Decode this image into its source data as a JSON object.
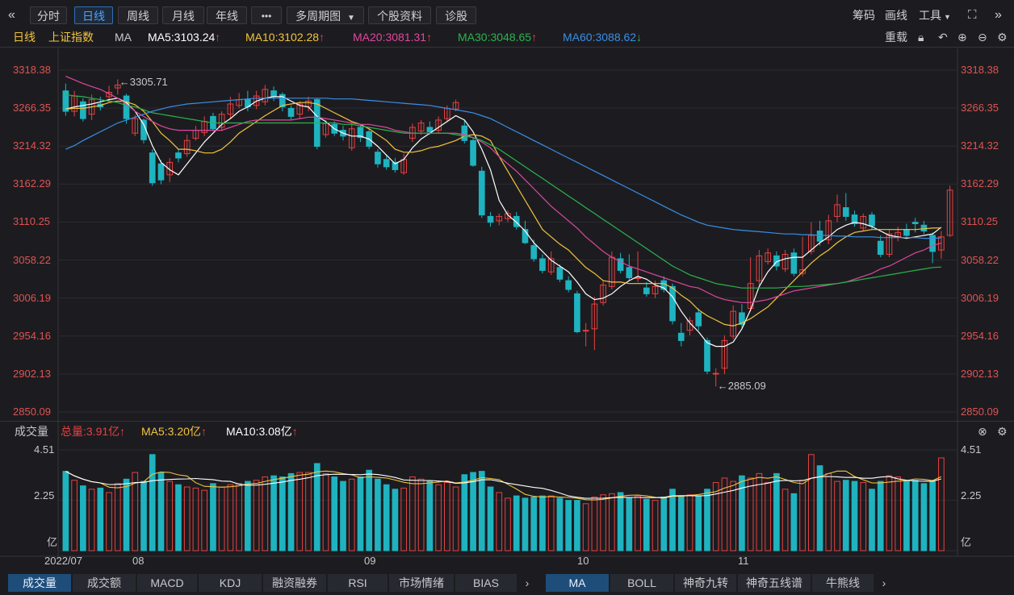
{
  "toolbar": {
    "back_icon": "«",
    "tabs": [
      "分时",
      "日线",
      "周线",
      "月线",
      "年线"
    ],
    "more_icon": "•••",
    "multi_period": "多周期图",
    "stock_info": "个股资料",
    "diagnose": "诊股",
    "right": [
      "筹码",
      "画线",
      "工具"
    ],
    "expand_icon": "⛶",
    "collapse_icon": "»"
  },
  "ma_bar": {
    "period": "日线",
    "index_name": "上证指数",
    "ma_label": "MA",
    "ma5": "MA5:3103.24",
    "ma10": "MA10:3102.28",
    "ma20": "MA20:3081.31",
    "ma30": "MA30:3048.65",
    "ma60": "MA60:3088.62",
    "reweight": "重载",
    "colors": {
      "ma5": "#ffffff",
      "ma10": "#f3c33c",
      "ma20": "#e0479e",
      "ma30": "#2bb34d",
      "ma60": "#3a8ee6"
    }
  },
  "price_axis": [
    "3318.38",
    "3266.35",
    "3214.32",
    "3162.29",
    "3110.25",
    "3058.22",
    "3006.19",
    "2954.16",
    "2902.13",
    "2850.09"
  ],
  "annotations": {
    "high": "3305.71",
    "low": "2885.09"
  },
  "volume_bar": {
    "label": "成交量",
    "total": "总量:3.91亿",
    "ma5": "MA5:3.20亿",
    "ma10": "MA10:3.08亿"
  },
  "volume_axis": [
    "4.51",
    "2.25",
    "亿"
  ],
  "x_axis": [
    "2022/07",
    "08",
    "09",
    "10",
    "11"
  ],
  "bottom_tabs_left": [
    "成交量",
    "成交额",
    "MACD",
    "KDJ",
    "融资融券",
    "RSI",
    "市场情绪",
    "BIAS"
  ],
  "bottom_tabs_right": [
    "MA",
    "BOLL",
    "神奇九转",
    "神奇五线谱",
    "牛熊线"
  ],
  "chart_data": {
    "type": "candlestick",
    "ylim": [
      2850.09,
      3318.38
    ],
    "volume_ylim": [
      0,
      4.51
    ],
    "candles": [
      [
        3290,
        3262,
        3300,
        3256
      ],
      [
        3262,
        3283,
        3290,
        3255
      ],
      [
        3275,
        3252,
        3280,
        3248
      ],
      [
        3258,
        3278,
        3285,
        3250
      ],
      [
        3272,
        3268,
        3282,
        3263
      ],
      [
        3282,
        3288,
        3297,
        3275
      ],
      [
        3294,
        3298,
        3305.71,
        3285
      ],
      [
        3283,
        3252,
        3286,
        3245
      ],
      [
        3232,
        3252,
        3257,
        3228
      ],
      [
        3250,
        3223,
        3252,
        3218
      ],
      [
        3205,
        3164,
        3210,
        3160
      ],
      [
        3190,
        3168,
        3195,
        3162
      ],
      [
        3175,
        3192,
        3198,
        3165
      ],
      [
        3205,
        3198,
        3210,
        3192
      ],
      [
        3204,
        3222,
        3230,
        3200
      ],
      [
        3225,
        3236,
        3242,
        3222
      ],
      [
        3233,
        3248,
        3255,
        3228
      ],
      [
        3255,
        3238,
        3260,
        3235
      ],
      [
        3240,
        3258,
        3262,
        3235
      ],
      [
        3258,
        3272,
        3282,
        3252
      ],
      [
        3270,
        3278,
        3287,
        3266
      ],
      [
        3278,
        3268,
        3290,
        3262
      ],
      [
        3270,
        3283,
        3290,
        3265
      ],
      [
        3275,
        3292,
        3298,
        3270
      ],
      [
        3290,
        3282,
        3296,
        3276
      ],
      [
        3285,
        3268,
        3288,
        3262
      ],
      [
        3266,
        3255,
        3270,
        3250
      ],
      [
        3258,
        3272,
        3276,
        3252
      ],
      [
        3268,
        3276,
        3282,
        3262
      ],
      [
        3278,
        3214,
        3280,
        3210
      ],
      [
        3230,
        3245,
        3250,
        3226
      ],
      [
        3244,
        3232,
        3248,
        3228
      ],
      [
        3236,
        3228,
        3242,
        3222
      ],
      [
        3212,
        3238,
        3247,
        3208
      ],
      [
        3240,
        3226,
        3244,
        3220
      ],
      [
        3234,
        3214,
        3238,
        3210
      ],
      [
        3206,
        3190,
        3210,
        3185
      ],
      [
        3196,
        3186,
        3202,
        3182
      ],
      [
        3192,
        3182,
        3198,
        3178
      ],
      [
        3178,
        3196,
        3204,
        3175
      ],
      [
        3225,
        3240,
        3245,
        3220
      ],
      [
        3235,
        3246,
        3250,
        3230
      ],
      [
        3240,
        3234,
        3248,
        3230
      ],
      [
        3236,
        3250,
        3255,
        3232
      ],
      [
        3252,
        3266,
        3270,
        3248
      ],
      [
        3265,
        3274,
        3278,
        3262
      ],
      [
        3242,
        3222,
        3250,
        3218
      ],
      [
        3222,
        3188,
        3226,
        3186
      ],
      [
        3180,
        3120,
        3186,
        3116
      ],
      [
        3118,
        3110,
        3124,
        3104
      ],
      [
        3112,
        3118,
        3122,
        3106
      ],
      [
        3115,
        3122,
        3126,
        3110
      ],
      [
        3118,
        3104,
        3124,
        3100
      ],
      [
        3100,
        3082,
        3112,
        3080
      ],
      [
        3078,
        3060,
        3086,
        3056
      ],
      [
        3060,
        3044,
        3066,
        3040
      ],
      [
        3042,
        3060,
        3070,
        3038
      ],
      [
        3048,
        3032,
        3052,
        3028
      ],
      [
        3030,
        3018,
        3036,
        3014
      ],
      [
        3012,
        2960,
        3016,
        2958
      ],
      [
        2962,
        2962,
        2972,
        2940
      ],
      [
        2964,
        2998,
        3008,
        2935
      ],
      [
        3000,
        3024,
        3030,
        2996
      ],
      [
        3022,
        3062,
        3070,
        3018
      ],
      [
        3060,
        3044,
        3068,
        3040
      ],
      [
        3048,
        3034,
        3066,
        3030
      ],
      [
        3034,
        3034,
        3070,
        3028
      ],
      [
        3020,
        3012,
        3028,
        3008
      ],
      [
        3012,
        3022,
        3030,
        3006
      ],
      [
        3030,
        3018,
        3036,
        3014
      ],
      [
        3022,
        2975,
        3026,
        2970
      ],
      [
        2958,
        2948,
        2972,
        2940
      ],
      [
        2962,
        2975,
        2980,
        2955
      ],
      [
        2986,
        2968,
        2992,
        2962
      ],
      [
        2948,
        2906,
        2952,
        2902
      ],
      [
        2902,
        2903,
        2910,
        2885.09
      ],
      [
        2910,
        2948,
        2955,
        2902
      ],
      [
        2954,
        2988,
        2996,
        2950
      ],
      [
        2986,
        2970,
        2998,
        2966
      ],
      [
        2992,
        3026,
        3062,
        2988
      ],
      [
        3030,
        3064,
        3072,
        3024
      ],
      [
        3056,
        3068,
        3074,
        3052
      ],
      [
        3064,
        3050,
        3070,
        3044
      ],
      [
        3046,
        3066,
        3072,
        3042
      ],
      [
        3068,
        3040,
        3074,
        3036
      ],
      [
        3040,
        3045,
        3090,
        3036
      ],
      [
        3070,
        3092,
        3110,
        3066
      ],
      [
        3098,
        3084,
        3112,
        3078
      ],
      [
        3086,
        3112,
        3120,
        3080
      ],
      [
        3118,
        3134,
        3148,
        3110
      ],
      [
        3130,
        3118,
        3150,
        3112
      ],
      [
        3120,
        3108,
        3126,
        3104
      ],
      [
        3102,
        3118,
        3122,
        3098
      ],
      [
        3120,
        3105,
        3124,
        3100
      ],
      [
        3084,
        3066,
        3092,
        3062
      ],
      [
        3066,
        3094,
        3100,
        3062
      ],
      [
        3090,
        3096,
        3104,
        3084
      ],
      [
        3100,
        3092,
        3108,
        3088
      ],
      [
        3110,
        3108,
        3116,
        3096
      ],
      [
        3106,
        3098,
        3112,
        3094
      ],
      [
        3092,
        3070,
        3096,
        3054
      ],
      [
        3072,
        3090,
        3098,
        3060
      ],
      [
        3092,
        3154,
        3160,
        3090
      ]
    ],
    "volume": [
      3.55,
      3.15,
      2.9,
      2.75,
      2.8,
      2.6,
      3.0,
      3.2,
      3.5,
      3.1,
      4.3,
      3.5,
      3.1,
      2.95,
      2.85,
      2.8,
      2.7,
      3.0,
      2.85,
      2.95,
      3.0,
      3.1,
      3.15,
      3.3,
      3.35,
      3.3,
      3.45,
      3.5,
      3.5,
      3.9,
      3.45,
      3.3,
      3.1,
      3.2,
      3.3,
      3.6,
      3.2,
      2.95,
      2.75,
      2.8,
      3.3,
      3.2,
      3.1,
      2.95,
      3.05,
      2.85,
      3.4,
      3.5,
      3.55,
      2.85,
      2.6,
      2.35,
      2.45,
      2.35,
      2.4,
      2.45,
      2.45,
      2.35,
      2.25,
      2.25,
      2.1,
      2.4,
      2.5,
      2.55,
      2.6,
      2.35,
      2.45,
      2.3,
      2.25,
      2.4,
      2.75,
      2.45,
      2.5,
      2.45,
      2.75,
      3.05,
      3.25,
      3.1,
      3.35,
      3.25,
      3.45,
      3.05,
      3.45,
      2.75,
      2.55,
      3.15,
      4.3,
      3.8,
      3.45,
      3.1,
      3.15,
      3.1,
      3.05,
      2.75,
      3.1,
      3.35,
      3.3,
      3.15,
      3.15,
      3.0,
      3.1,
      4.15
    ],
    "ma_series": {
      "MA5": [
        3265,
        3268,
        3270,
        3272,
        3275,
        3278,
        3280,
        3274,
        3262,
        3244,
        3215,
        3192,
        3182,
        3175,
        3190,
        3205,
        3220,
        3232,
        3244,
        3252,
        3262,
        3268,
        3276,
        3280,
        3282,
        3282,
        3276,
        3270,
        3268,
        3255,
        3248,
        3238,
        3232,
        3228,
        3228,
        3224,
        3214,
        3202,
        3190,
        3196,
        3212,
        3224,
        3232,
        3240,
        3248,
        3256,
        3250,
        3234,
        3210,
        3182,
        3140,
        3120,
        3110,
        3098,
        3082,
        3070,
        3058,
        3050,
        3042,
        3028,
        3012,
        3004,
        3006,
        3012,
        3022,
        3030,
        3036,
        3032,
        3024,
        3020,
        3008,
        2988,
        2972,
        2960,
        2945,
        2940,
        2940,
        2946,
        2964,
        2990,
        3022,
        3042,
        3056,
        3060,
        3062,
        3062,
        3072,
        3082,
        3090,
        3100,
        3106,
        3110,
        3108,
        3104,
        3098,
        3092,
        3090,
        3088,
        3090,
        3092,
        3094,
        3103.24
      ],
      "MA10": [
        3265,
        3266,
        3266,
        3268,
        3270,
        3274,
        3276,
        3275,
        3271,
        3262,
        3248,
        3232,
        3222,
        3210,
        3210,
        3208,
        3205,
        3205,
        3210,
        3220,
        3232,
        3240,
        3248,
        3256,
        3263,
        3270,
        3272,
        3274,
        3274,
        3272,
        3266,
        3260,
        3254,
        3248,
        3244,
        3238,
        3230,
        3222,
        3210,
        3206,
        3206,
        3208,
        3212,
        3214,
        3218,
        3222,
        3228,
        3230,
        3228,
        3222,
        3200,
        3180,
        3160,
        3140,
        3120,
        3100,
        3090,
        3080,
        3072,
        3060,
        3048,
        3040,
        3030,
        3028,
        3028,
        3026,
        3026,
        3026,
        3026,
        3026,
        3020,
        3010,
        3002,
        2990,
        2982,
        2976,
        2970,
        2968,
        2972,
        2978,
        2986,
        2994,
        3006,
        3018,
        3030,
        3042,
        3054,
        3064,
        3072,
        3082,
        3090,
        3096,
        3098,
        3100,
        3100,
        3100,
        3100,
        3100,
        3100,
        3101,
        3102,
        3102.28
      ],
      "MA20": [
        3310,
        3305,
        3300,
        3296,
        3292,
        3286,
        3280,
        3272,
        3262,
        3255,
        3248,
        3242,
        3238,
        3236,
        3236,
        3236,
        3236,
        3236,
        3236,
        3240,
        3244,
        3248,
        3250,
        3250,
        3250,
        3250,
        3250,
        3252,
        3254,
        3254,
        3252,
        3250,
        3248,
        3246,
        3244,
        3244,
        3242,
        3240,
        3236,
        3234,
        3232,
        3232,
        3232,
        3232,
        3232,
        3232,
        3230,
        3226,
        3220,
        3212,
        3200,
        3190,
        3180,
        3168,
        3156,
        3144,
        3132,
        3122,
        3112,
        3102,
        3090,
        3080,
        3070,
        3062,
        3056,
        3050,
        3046,
        3042,
        3038,
        3034,
        3030,
        3026,
        3022,
        3020,
        3014,
        3008,
        3004,
        3002,
        3000,
        3000,
        3002,
        3004,
        3008,
        3012,
        3016,
        3018,
        3020,
        3022,
        3024,
        3026,
        3028,
        3032,
        3036,
        3040,
        3046,
        3050,
        3056,
        3062,
        3068,
        3072,
        3078,
        3081.31
      ],
      "MA30": [
        3285,
        3283,
        3282,
        3280,
        3278,
        3276,
        3274,
        3270,
        3268,
        3264,
        3260,
        3258,
        3256,
        3254,
        3252,
        3250,
        3248,
        3246,
        3246,
        3246,
        3246,
        3246,
        3246,
        3246,
        3246,
        3246,
        3246,
        3246,
        3246,
        3246,
        3246,
        3246,
        3244,
        3244,
        3242,
        3240,
        3238,
        3236,
        3234,
        3232,
        3232,
        3232,
        3232,
        3232,
        3232,
        3230,
        3228,
        3226,
        3222,
        3216,
        3210,
        3202,
        3194,
        3186,
        3178,
        3170,
        3162,
        3154,
        3146,
        3138,
        3130,
        3122,
        3114,
        3106,
        3098,
        3090,
        3082,
        3074,
        3066,
        3058,
        3050,
        3044,
        3038,
        3034,
        3030,
        3026,
        3024,
        3022,
        3020,
        3020,
        3020,
        3020,
        3020,
        3021,
        3022,
        3022,
        3023,
        3024,
        3025,
        3026,
        3028,
        3030,
        3032,
        3034,
        3036,
        3038,
        3040,
        3042,
        3044,
        3046,
        3048,
        3048.65
      ],
      "MA60": [
        3210,
        3215,
        3222,
        3228,
        3234,
        3240,
        3246,
        3250,
        3254,
        3258,
        3262,
        3265,
        3268,
        3270,
        3272,
        3273,
        3274,
        3275,
        3276,
        3277,
        3278,
        3279,
        3280,
        3280,
        3280,
        3280,
        3280,
        3280,
        3280,
        3280,
        3280,
        3279,
        3279,
        3279,
        3278,
        3277,
        3276,
        3275,
        3274,
        3273,
        3272,
        3271,
        3270,
        3268,
        3266,
        3264,
        3262,
        3260,
        3256,
        3252,
        3246,
        3240,
        3234,
        3228,
        3222,
        3216,
        3210,
        3204,
        3198,
        3192,
        3186,
        3180,
        3174,
        3168,
        3162,
        3156,
        3150,
        3144,
        3138,
        3132,
        3126,
        3120,
        3115,
        3110,
        3106,
        3104,
        3102,
        3100,
        3099,
        3098,
        3097,
        3096,
        3095,
        3094,
        3094,
        3093,
        3093,
        3092,
        3092,
        3091,
        3091,
        3090,
        3090,
        3090,
        3089,
        3089,
        3089,
        3089,
        3089,
        3088,
        3088,
        3088.62
      ]
    }
  }
}
